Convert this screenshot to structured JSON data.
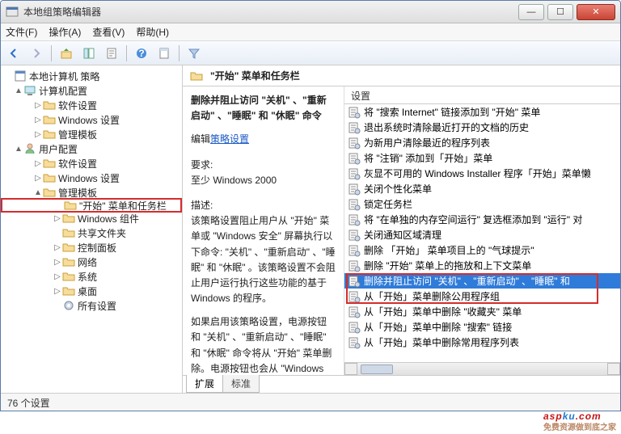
{
  "window": {
    "title": "本地组策略编辑器",
    "min": "—",
    "max": "☐",
    "close": "✕"
  },
  "menu": {
    "file": "文件(F)",
    "action": "操作(A)",
    "view": "查看(V)",
    "help": "帮助(H)"
  },
  "tree": {
    "root": "本地计算机 策略",
    "computer": "计算机配置",
    "c_soft": "软件设置",
    "c_win": "Windows 设置",
    "c_admin": "管理模板",
    "user": "用户配置",
    "u_soft": "软件设置",
    "u_win": "Windows 设置",
    "u_admin": "管理模板",
    "start": "\"开始\" 菜单和任务栏",
    "wincomp": "Windows 组件",
    "shared": "共享文件夹",
    "cpl": "控制面板",
    "net": "网络",
    "sys": "系统",
    "desk": "桌面",
    "all": "所有设置"
  },
  "path": {
    "label": "\"开始\" 菜单和任务栏"
  },
  "desc": {
    "title": "删除并阻止访问 \"关机\" 、\"重新启动\" 、\"睡眠\" 和 \"休眠\" 命令",
    "edit_prefix": "编辑",
    "edit_link": "策略设置",
    "req_label": "要求:",
    "req_value": "至少 Windows 2000",
    "d_label": "描述:",
    "d_body1": "该策略设置阻止用户从 \"开始\" 菜单或 \"Windows 安全\" 屏幕执行以下命令: \"关机\" 、\"重新启动\" 、\"睡眠\" 和 \"休眠\" 。该策略设置不会阻止用户运行执行这些功能的基于 Windows 的程序。",
    "d_body2": "如果启用该策略设置，电源按钮和 \"关机\" 、\"重新启动\" 、\"睡眠\" 和 \"休眠\" 命令将从 \"开始\" 菜单删除。电源按钮也会从 \"Windows 安全\" 屏幕删除。该屏幕"
  },
  "settings": {
    "header": "设置",
    "items": [
      "将 \"搜索 Internet\" 链接添加到 \"开始\" 菜单",
      "退出系统时清除最近打开的文档的历史",
      "为新用户清除最近的程序列表",
      "将 \"注销\" 添加到「开始」菜单",
      "灰显不可用的 Windows Installer 程序「开始」菜单懒",
      "关闭个性化菜单",
      "锁定任务栏",
      "将 \"在单独的内存空间运行\" 复选框添加到 \"运行\" 对",
      "关闭通知区域清理",
      "删除 「开始」 菜单项目上的 \"气球提示\"",
      "删除 \"开始\" 菜单上的拖放和上下文菜单",
      "删除并阻止访问 \"关机\" 、\"重新启动\" 、\"睡眠\" 和",
      "从「开始」菜单删除公用程序组",
      "从「开始」菜单中删除 \"收藏夹\" 菜单",
      "从「开始」菜单中删除 \"搜索\" 链接",
      "从「开始」菜单中删除常用程序列表"
    ],
    "selected_index": 11
  },
  "tabs": {
    "ext": "扩展",
    "std": "标准"
  },
  "status": {
    "count": "76 个设置"
  },
  "brand": {
    "a": "asp",
    "b": "ku",
    "c": ".com",
    "sub": "免费资源做到底之家"
  }
}
